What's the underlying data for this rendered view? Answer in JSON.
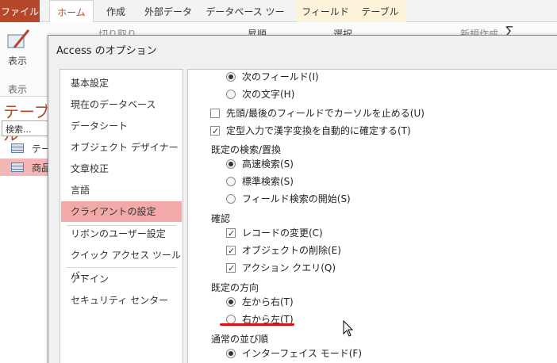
{
  "ribbon": {
    "tabs": [
      "ファイル",
      "ホーム",
      "作成",
      "外部データ",
      "データベース ツール",
      "フィールド",
      "テーブル"
    ],
    "view_label": "表示",
    "view_group": "表示",
    "cut_label": "切り取り",
    "sort_label": "昇順",
    "select_label": "選択",
    "new_label": "新規作成"
  },
  "nav": {
    "title": "テーブル",
    "search_placeholder": "検索...",
    "items": [
      "テー",
      "商品"
    ]
  },
  "dialog": {
    "title": "Access のオプション",
    "categories": [
      "基本設定",
      "現在のデータベース",
      "データシート",
      "オブジェクト デザイナー",
      "文章校正",
      "言語",
      "クライアントの設定",
      "リボンのユーザー設定",
      "クイック アクセス ツール バー",
      "アドイン",
      "セキュリティ センター"
    ],
    "selected_category": "クライアントの設定",
    "options": {
      "next_field": "次のフィールド(I)",
      "next_char": "次の文字(H)",
      "stop_cursor": "先頭/最後のフィールドでカーソルを止める(U)",
      "ime_auto": "定型入力で漢字変換を自動的に確定する(T)",
      "search_heading": "既定の検索/置換",
      "fast_search": "高速検索(S)",
      "standard_search": "標準検索(S)",
      "start_field_search": "フィールド検索の開始(S)",
      "confirm_heading": "確認",
      "record_change": "レコードの変更(C)",
      "object_delete": "オブジェクトの削除(E)",
      "action_query": "アクション クエリ(Q)",
      "direction_heading": "既定の方向",
      "ltr": "左から右(T)",
      "rtl": "右から左(T)",
      "sort_heading": "通常の並び順",
      "interface_mode": "インターフェイス モード(F)"
    }
  },
  "colors": {
    "accent": "#b7472a",
    "selected_category": "#f4a9a9",
    "annotation_line": "#e01010"
  }
}
